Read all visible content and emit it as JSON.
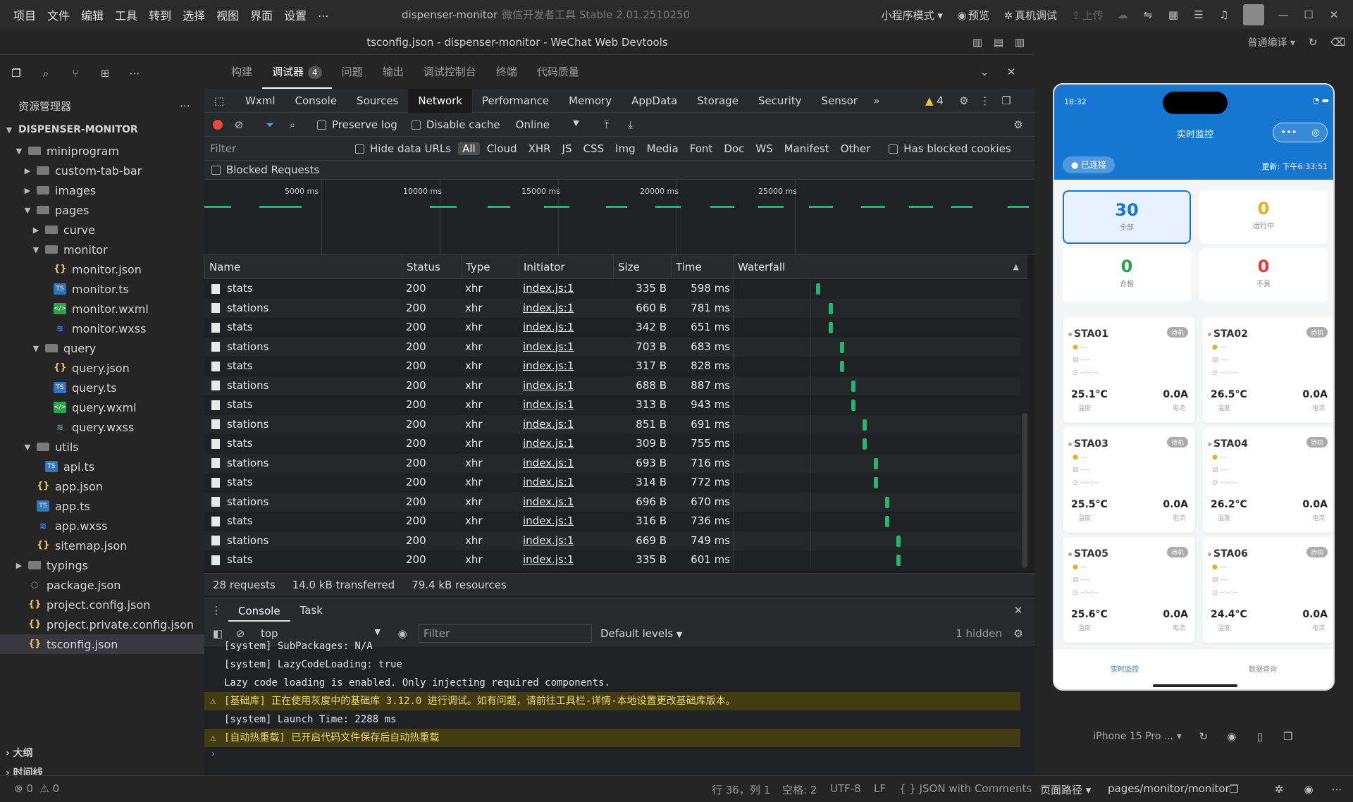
{
  "menu": [
    "项目",
    "文件",
    "编辑",
    "工具",
    "转到",
    "选择",
    "视图",
    "界面",
    "设置",
    "..."
  ],
  "window": {
    "title": "dispenser-monitor",
    "subtitle": "微信开发者工具 Stable 2.01.2510250",
    "mode": "小程序模式",
    "preview": "预览",
    "remote_debug": "真机调试",
    "upload": "上传"
  },
  "file_title": "tsconfig.json - dispenser-monitor - WeChat Web Devtools",
  "compile": "普通编译",
  "explorer": {
    "title": "资源管理器",
    "project": "DISPENSER-MONITOR",
    "outline": "大纲",
    "timeline": "时间线"
  },
  "tree": [
    {
      "label": "miniprogram",
      "type": "folder",
      "depth": 1,
      "open": true
    },
    {
      "label": "custom-tab-bar",
      "type": "folder",
      "depth": 2,
      "open": false
    },
    {
      "label": "images",
      "type": "folder",
      "depth": 2,
      "open": false
    },
    {
      "label": "pages",
      "type": "folder",
      "depth": 2,
      "open": true
    },
    {
      "label": "curve",
      "type": "folder",
      "depth": 3,
      "open": false
    },
    {
      "label": "monitor",
      "type": "folder",
      "depth": 3,
      "open": true
    },
    {
      "label": "monitor.json",
      "type": "json",
      "depth": 4
    },
    {
      "label": "monitor.ts",
      "type": "ts",
      "depth": 4
    },
    {
      "label": "monitor.wxml",
      "type": "wxml",
      "depth": 4
    },
    {
      "label": "monitor.wxss",
      "type": "wxss",
      "depth": 4
    },
    {
      "label": "query",
      "type": "folder",
      "depth": 3,
      "open": true
    },
    {
      "label": "query.json",
      "type": "json",
      "depth": 4
    },
    {
      "label": "query.ts",
      "type": "ts",
      "depth": 4
    },
    {
      "label": "query.wxml",
      "type": "wxml",
      "depth": 4
    },
    {
      "label": "query.wxss",
      "type": "wxss",
      "depth": 4
    },
    {
      "label": "utils",
      "type": "folder",
      "depth": 2,
      "open": true
    },
    {
      "label": "api.ts",
      "type": "ts",
      "depth": 3
    },
    {
      "label": "app.json",
      "type": "json",
      "depth": 2
    },
    {
      "label": "app.ts",
      "type": "ts",
      "depth": 2
    },
    {
      "label": "app.wxss",
      "type": "wxss",
      "depth": 2
    },
    {
      "label": "sitemap.json",
      "type": "json",
      "depth": 2
    },
    {
      "label": "typings",
      "type": "folder",
      "depth": 1,
      "open": false
    },
    {
      "label": "package.json",
      "type": "pkg",
      "depth": 1
    },
    {
      "label": "project.config.json",
      "type": "json",
      "depth": 1
    },
    {
      "label": "project.private.config.json",
      "type": "json",
      "depth": 1
    },
    {
      "label": "tsconfig.json",
      "type": "json",
      "depth": 1,
      "selected": true
    }
  ],
  "devtabs": [
    {
      "label": "构建"
    },
    {
      "label": "调试器",
      "badge": "4",
      "active": true
    },
    {
      "label": "问题"
    },
    {
      "label": "输出"
    },
    {
      "label": "调试控制台"
    },
    {
      "label": "终端"
    },
    {
      "label": "代码质量"
    }
  ],
  "panels": [
    {
      "label": "Wxml"
    },
    {
      "label": "Console"
    },
    {
      "label": "Sources"
    },
    {
      "label": "Network",
      "active": true
    },
    {
      "label": "Performance"
    },
    {
      "label": "Memory"
    },
    {
      "label": "AppData"
    },
    {
      "label": "Storage"
    },
    {
      "label": "Security"
    },
    {
      "label": "Sensor"
    }
  ],
  "warn_count": "4",
  "network": {
    "preserve_log": "Preserve log",
    "disable_cache": "Disable cache",
    "throttle": "Online",
    "filter_placeholder": "Filter",
    "hide_data_urls": "Hide data URLs",
    "types": [
      "All",
      "Cloud",
      "XHR",
      "JS",
      "CSS",
      "Img",
      "Media",
      "Font",
      "Doc",
      "WS",
      "Manifest",
      "Other"
    ],
    "blocked_cookies": "Has blocked cookies",
    "blocked_requests": "Blocked Requests",
    "ticks": [
      "5000 ms",
      "10000 ms",
      "15000 ms",
      "20000 ms",
      "25000 ms"
    ],
    "columns": [
      "Name",
      "Status",
      "Type",
      "Initiator",
      "Size",
      "Time",
      "Waterfall"
    ],
    "rows": [
      {
        "name": "stats",
        "status": "200",
        "type": "xhr",
        "initiator": "index.js:1",
        "size": "335 B",
        "time": "598 ms"
      },
      {
        "name": "stations",
        "status": "200",
        "type": "xhr",
        "initiator": "index.js:1",
        "size": "660 B",
        "time": "781 ms"
      },
      {
        "name": "stats",
        "status": "200",
        "type": "xhr",
        "initiator": "index.js:1",
        "size": "342 B",
        "time": "651 ms"
      },
      {
        "name": "stations",
        "status": "200",
        "type": "xhr",
        "initiator": "index.js:1",
        "size": "703 B",
        "time": "683 ms"
      },
      {
        "name": "stats",
        "status": "200",
        "type": "xhr",
        "initiator": "index.js:1",
        "size": "317 B",
        "time": "828 ms"
      },
      {
        "name": "stations",
        "status": "200",
        "type": "xhr",
        "initiator": "index.js:1",
        "size": "688 B",
        "time": "887 ms"
      },
      {
        "name": "stats",
        "status": "200",
        "type": "xhr",
        "initiator": "index.js:1",
        "size": "313 B",
        "time": "943 ms"
      },
      {
        "name": "stations",
        "status": "200",
        "type": "xhr",
        "initiator": "index.js:1",
        "size": "851 B",
        "time": "691 ms"
      },
      {
        "name": "stats",
        "status": "200",
        "type": "xhr",
        "initiator": "index.js:1",
        "size": "309 B",
        "time": "755 ms"
      },
      {
        "name": "stations",
        "status": "200",
        "type": "xhr",
        "initiator": "index.js:1",
        "size": "693 B",
        "time": "716 ms"
      },
      {
        "name": "stats",
        "status": "200",
        "type": "xhr",
        "initiator": "index.js:1",
        "size": "314 B",
        "time": "772 ms"
      },
      {
        "name": "stations",
        "status": "200",
        "type": "xhr",
        "initiator": "index.js:1",
        "size": "696 B",
        "time": "670 ms"
      },
      {
        "name": "stats",
        "status": "200",
        "type": "xhr",
        "initiator": "index.js:1",
        "size": "316 B",
        "time": "736 ms"
      },
      {
        "name": "stations",
        "status": "200",
        "type": "xhr",
        "initiator": "index.js:1",
        "size": "669 B",
        "time": "749 ms"
      },
      {
        "name": "stats",
        "status": "200",
        "type": "xhr",
        "initiator": "index.js:1",
        "size": "335 B",
        "time": "601 ms"
      }
    ],
    "summary": {
      "requests": "28 requests",
      "transferred": "14.0 kB transferred",
      "resources": "79.4 kB resources"
    }
  },
  "drawer": {
    "tabs": [
      "Console",
      "Task"
    ],
    "context": "top",
    "filter_placeholder": "Filter",
    "levels": "Default levels",
    "hidden": "1 hidden"
  },
  "console": [
    {
      "text": "[system] SubPackages: N/A",
      "level": "log"
    },
    {
      "text": "[system] LazyCodeLoading: true",
      "level": "log"
    },
    {
      "text": "Lazy code loading is enabled. Only injecting required components.",
      "level": "log"
    },
    {
      "text": "[基础库] 正在使用灰度中的基础库 3.12.0 进行调试。如有问题，请前往工具栏-详情-本地设置更改基础库版本。",
      "level": "warn"
    },
    {
      "text": "[system] Launch Time: 2288 ms",
      "level": "log"
    },
    {
      "text": "[自动热重载] 已开启代码文件保存后自动热重载",
      "level": "warn"
    }
  ],
  "status": {
    "errors": "0",
    "warnings": "0",
    "position": "行 36，列 1",
    "spaces": "空格: 2",
    "encoding": "UTF-8",
    "eol": "LF",
    "language": "JSON with Comments",
    "page_path_label": "页面路径",
    "page_path": "pages/monitor/monitor"
  },
  "phone": {
    "time": "18:32",
    "title": "实时监控",
    "connected": "已连接",
    "updated": "更新: 下午6:33:51",
    "stats": [
      {
        "value": "30",
        "label": "全部",
        "color": "#1677d2"
      },
      {
        "value": "0",
        "label": "运行中",
        "color": "#f5a623"
      },
      {
        "value": "0",
        "label": "合格",
        "color": "#2aa14a"
      },
      {
        "value": "0",
        "label": "不良",
        "color": "#e53935"
      }
    ],
    "stations": [
      {
        "name": "STA01",
        "status": "待机",
        "temp": "25.1°C",
        "current": "0.0A"
      },
      {
        "name": "STA02",
        "status": "待机",
        "temp": "26.5°C",
        "current": "0.0A"
      },
      {
        "name": "STA03",
        "status": "待机",
        "temp": "25.5°C",
        "current": "0.0A"
      },
      {
        "name": "STA04",
        "status": "待机",
        "temp": "26.2°C",
        "current": "0.0A"
      },
      {
        "name": "STA05",
        "status": "待机",
        "temp": "25.6°C",
        "current": "0.0A"
      },
      {
        "name": "STA06",
        "status": "待机",
        "temp": "24.4°C",
        "current": "0.0A"
      }
    ],
    "line1": "---",
    "line2": "----",
    "line3": "--:--:--",
    "temp_label": "温度",
    "current_label": "电流",
    "tabs": [
      "实时监控",
      "数据查询"
    ],
    "device": "iPhone 15 Pro ..."
  }
}
